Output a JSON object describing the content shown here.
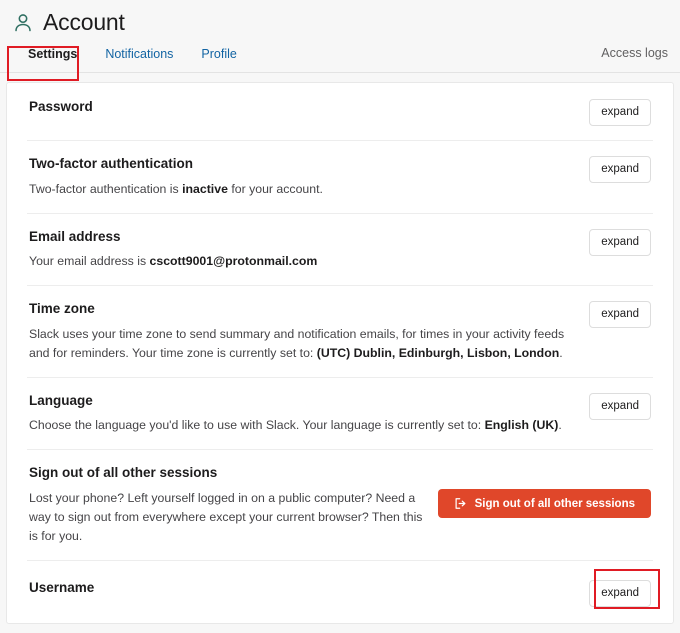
{
  "header": {
    "icon": "person-icon",
    "title": "Account"
  },
  "tabs": [
    {
      "label": "Settings",
      "active": true
    },
    {
      "label": "Notifications",
      "active": false
    },
    {
      "label": "Profile",
      "active": false
    }
  ],
  "access_logs_label": "Access logs",
  "sections": [
    {
      "name": "password",
      "title": "Password",
      "desc_html": "",
      "button": "expand"
    },
    {
      "name": "two-factor-authentication",
      "title": "Two-factor authentication",
      "desc_html": "Two-factor authentication is <b>inactive</b> for your account.",
      "button": "expand"
    },
    {
      "name": "email-address",
      "title": "Email address",
      "desc_html": "Your email address is <b>cscott9001@protonmail.com</b>",
      "button": "expand"
    },
    {
      "name": "time-zone",
      "title": "Time zone",
      "desc_html": "Slack uses your time zone to send summary and notification emails, for times in your activity feeds and for reminders. Your time zone is currently set to: <b>(UTC) Dublin, Edinburgh, Lisbon, London</b>.",
      "button": "expand"
    },
    {
      "name": "language",
      "title": "Language",
      "desc_html": "Choose the language you'd like to use with Slack. Your language is currently set to: <b>English (UK)</b>.",
      "button": "expand"
    }
  ],
  "signout": {
    "title": "Sign out of all other sessions",
    "desc": "Lost your phone? Left yourself logged in on a public computer? Need a way to sign out from everywhere except your current browser? Then this is for you.",
    "button_label": "Sign out of all other sessions",
    "button_icon": "sign-out-icon"
  },
  "username": {
    "title": "Username",
    "button": "expand"
  },
  "colors": {
    "page_background": "#f7f7f7",
    "card_background": "#ffffff",
    "link": "#1264a3",
    "danger": "#e0472a",
    "annotation": "#e01b24",
    "icon": "#2f6f62"
  },
  "annotations": [
    {
      "name": "annot-settings-tab",
      "target": "Settings"
    },
    {
      "name": "annot-username-expand",
      "target": "expand"
    }
  ]
}
